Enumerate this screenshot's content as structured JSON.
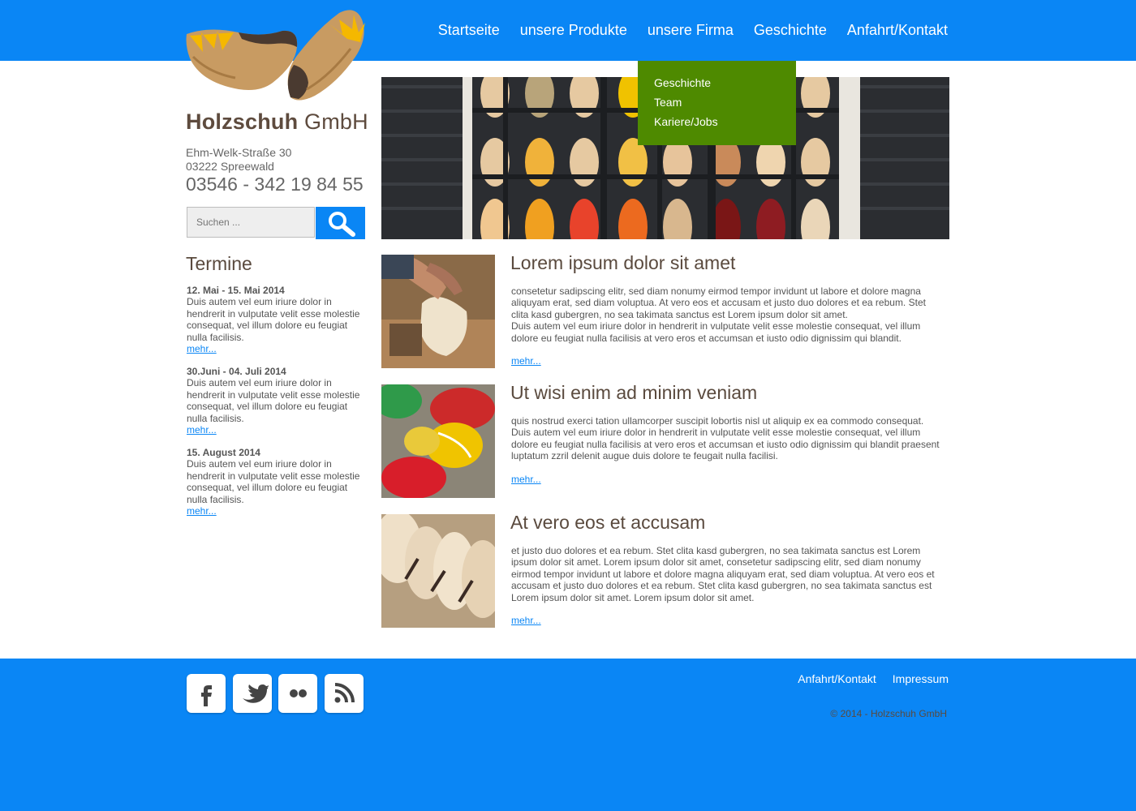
{
  "nav": {
    "items": [
      "Startseite",
      "unsere Produkte",
      "unsere Firma",
      "Geschichte",
      "Anfahrt/Kontakt"
    ]
  },
  "dropdown": {
    "items": [
      "Geschichte",
      "Team",
      "Kariere/Jobs"
    ]
  },
  "brand": {
    "name_bold": "Holzschuh",
    "name_light": "GmbH",
    "street": "Ehm-Welk-Straße 30",
    "city": "03222 Spreewald",
    "phone": "03546 - 342 19 84 55"
  },
  "search": {
    "placeholder": "Suchen ..."
  },
  "termine": {
    "title": "Termine",
    "events": [
      {
        "date": "12. Mai - 15. Mai 2014",
        "text": "Duis autem vel eum iriure dolor in hendrerit in vulputate velit esse molestie consequat, vel illum dolore eu feugiat nulla facilisis.",
        "more": "mehr..."
      },
      {
        "date": "30.Juni - 04. Juli 2014",
        "text": "Duis autem vel eum iriure dolor in hendrerit in vulputate velit esse molestie consequat, vel illum dolore eu feugiat nulla facilisis.",
        "more": "mehr..."
      },
      {
        "date": "15. August 2014",
        "text": "Duis autem vel eum iriure dolor in hendrerit in vulputate velit esse molestie consequat, vel illum dolore eu feugiat nulla facilisis.",
        "more": "mehr..."
      }
    ]
  },
  "articles": [
    {
      "title": "Lorem ipsum dolor sit amet",
      "p1": "consetetur sadipscing elitr, sed diam nonumy eirmod tempor invidunt ut labore et dolore magna aliquyam erat, sed diam voluptua. At vero eos et accusam et justo duo dolores et ea rebum. Stet clita kasd gubergren, no sea takimata sanctus est Lorem ipsum dolor sit amet.",
      "p2": "Duis autem vel eum iriure dolor in hendrerit in vulputate velit esse molestie consequat, vel illum dolore eu feugiat nulla facilisis at vero eros et accumsan et iusto odio dignissim qui blandit.",
      "more": "mehr..."
    },
    {
      "title": "Ut wisi enim ad minim veniam",
      "p1": "quis nostrud exerci tation ullamcorper suscipit lobortis nisl ut aliquip ex ea commodo consequat. Duis autem vel eum iriure dolor in hendrerit in vulputate velit esse molestie consequat, vel illum dolore eu feugiat nulla facilisis at vero eros et accumsan et iusto odio dignissim qui blandit praesent luptatum zzril delenit augue duis dolore te feugait nulla facilisi.",
      "p2": "",
      "more": "mehr..."
    },
    {
      "title": "At vero eos et accusam",
      "p1": " et justo duo dolores et ea rebum. Stet clita kasd gubergren, no sea takimata sanctus est Lorem ipsum dolor sit amet. Lorem ipsum dolor sit amet, consetetur sadipscing elitr, sed diam nonumy eirmod tempor invidunt ut labore et dolore magna aliquyam erat, sed diam voluptua. At vero eos et accusam et justo duo dolores et ea rebum. Stet clita kasd gubergren, no sea takimata sanctus est Lorem ipsum dolor sit amet. Lorem ipsum dolor sit amet.",
      "p2": "",
      "more": "mehr..."
    }
  ],
  "footer": {
    "links": [
      "Anfahrt/Kontakt",
      "Impressum"
    ],
    "copyright": "© 2014 - Holzschuh GmbH",
    "social": [
      "facebook-icon",
      "twitter-icon",
      "flickr-icon",
      "rss-icon"
    ]
  },
  "colors": {
    "primary": "#0a86f5",
    "dropdown": "#4e8a00",
    "brand_text": "#5e4b3e"
  }
}
